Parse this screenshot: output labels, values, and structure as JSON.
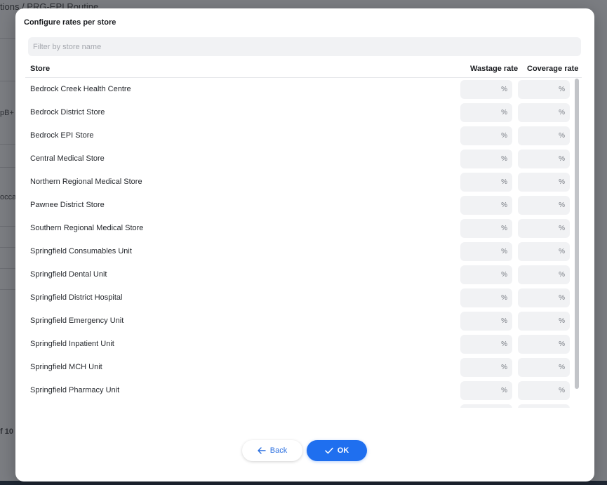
{
  "background": {
    "breadcrumb": "tions  /  PRG-EPI Routine",
    "fragments": [
      "pB+",
      "occa",
      "f 10"
    ]
  },
  "modal": {
    "title": "Configure rates per store",
    "filter_placeholder": "Filter by store name",
    "columns": {
      "store": "Store",
      "wastage": "Wastage rate",
      "coverage": "Coverage rate"
    },
    "percent_symbol": "%",
    "stores": [
      "Bedrock Creek Health Centre",
      "Bedrock District Store",
      "Bedrock EPI Store",
      "Central Medical Store",
      "Northern Regional Medical Store",
      "Pawnee District Store",
      "Southern Regional Medical Store",
      "Springfield Consumables Unit",
      "Springfield Dental Unit",
      "Springfield District Hospital",
      "Springfield Emergency Unit",
      "Springfield Inpatient Unit",
      "Springfield MCH Unit",
      "Springfield Pharmacy Unit"
    ],
    "back_label": "Back",
    "ok_label": "OK",
    "icons": {
      "back": "arrow-left-icon",
      "ok": "checkmark-icon"
    }
  },
  "colors": {
    "primary": "#1f6fef",
    "input_bg": "#f1f2f4"
  }
}
